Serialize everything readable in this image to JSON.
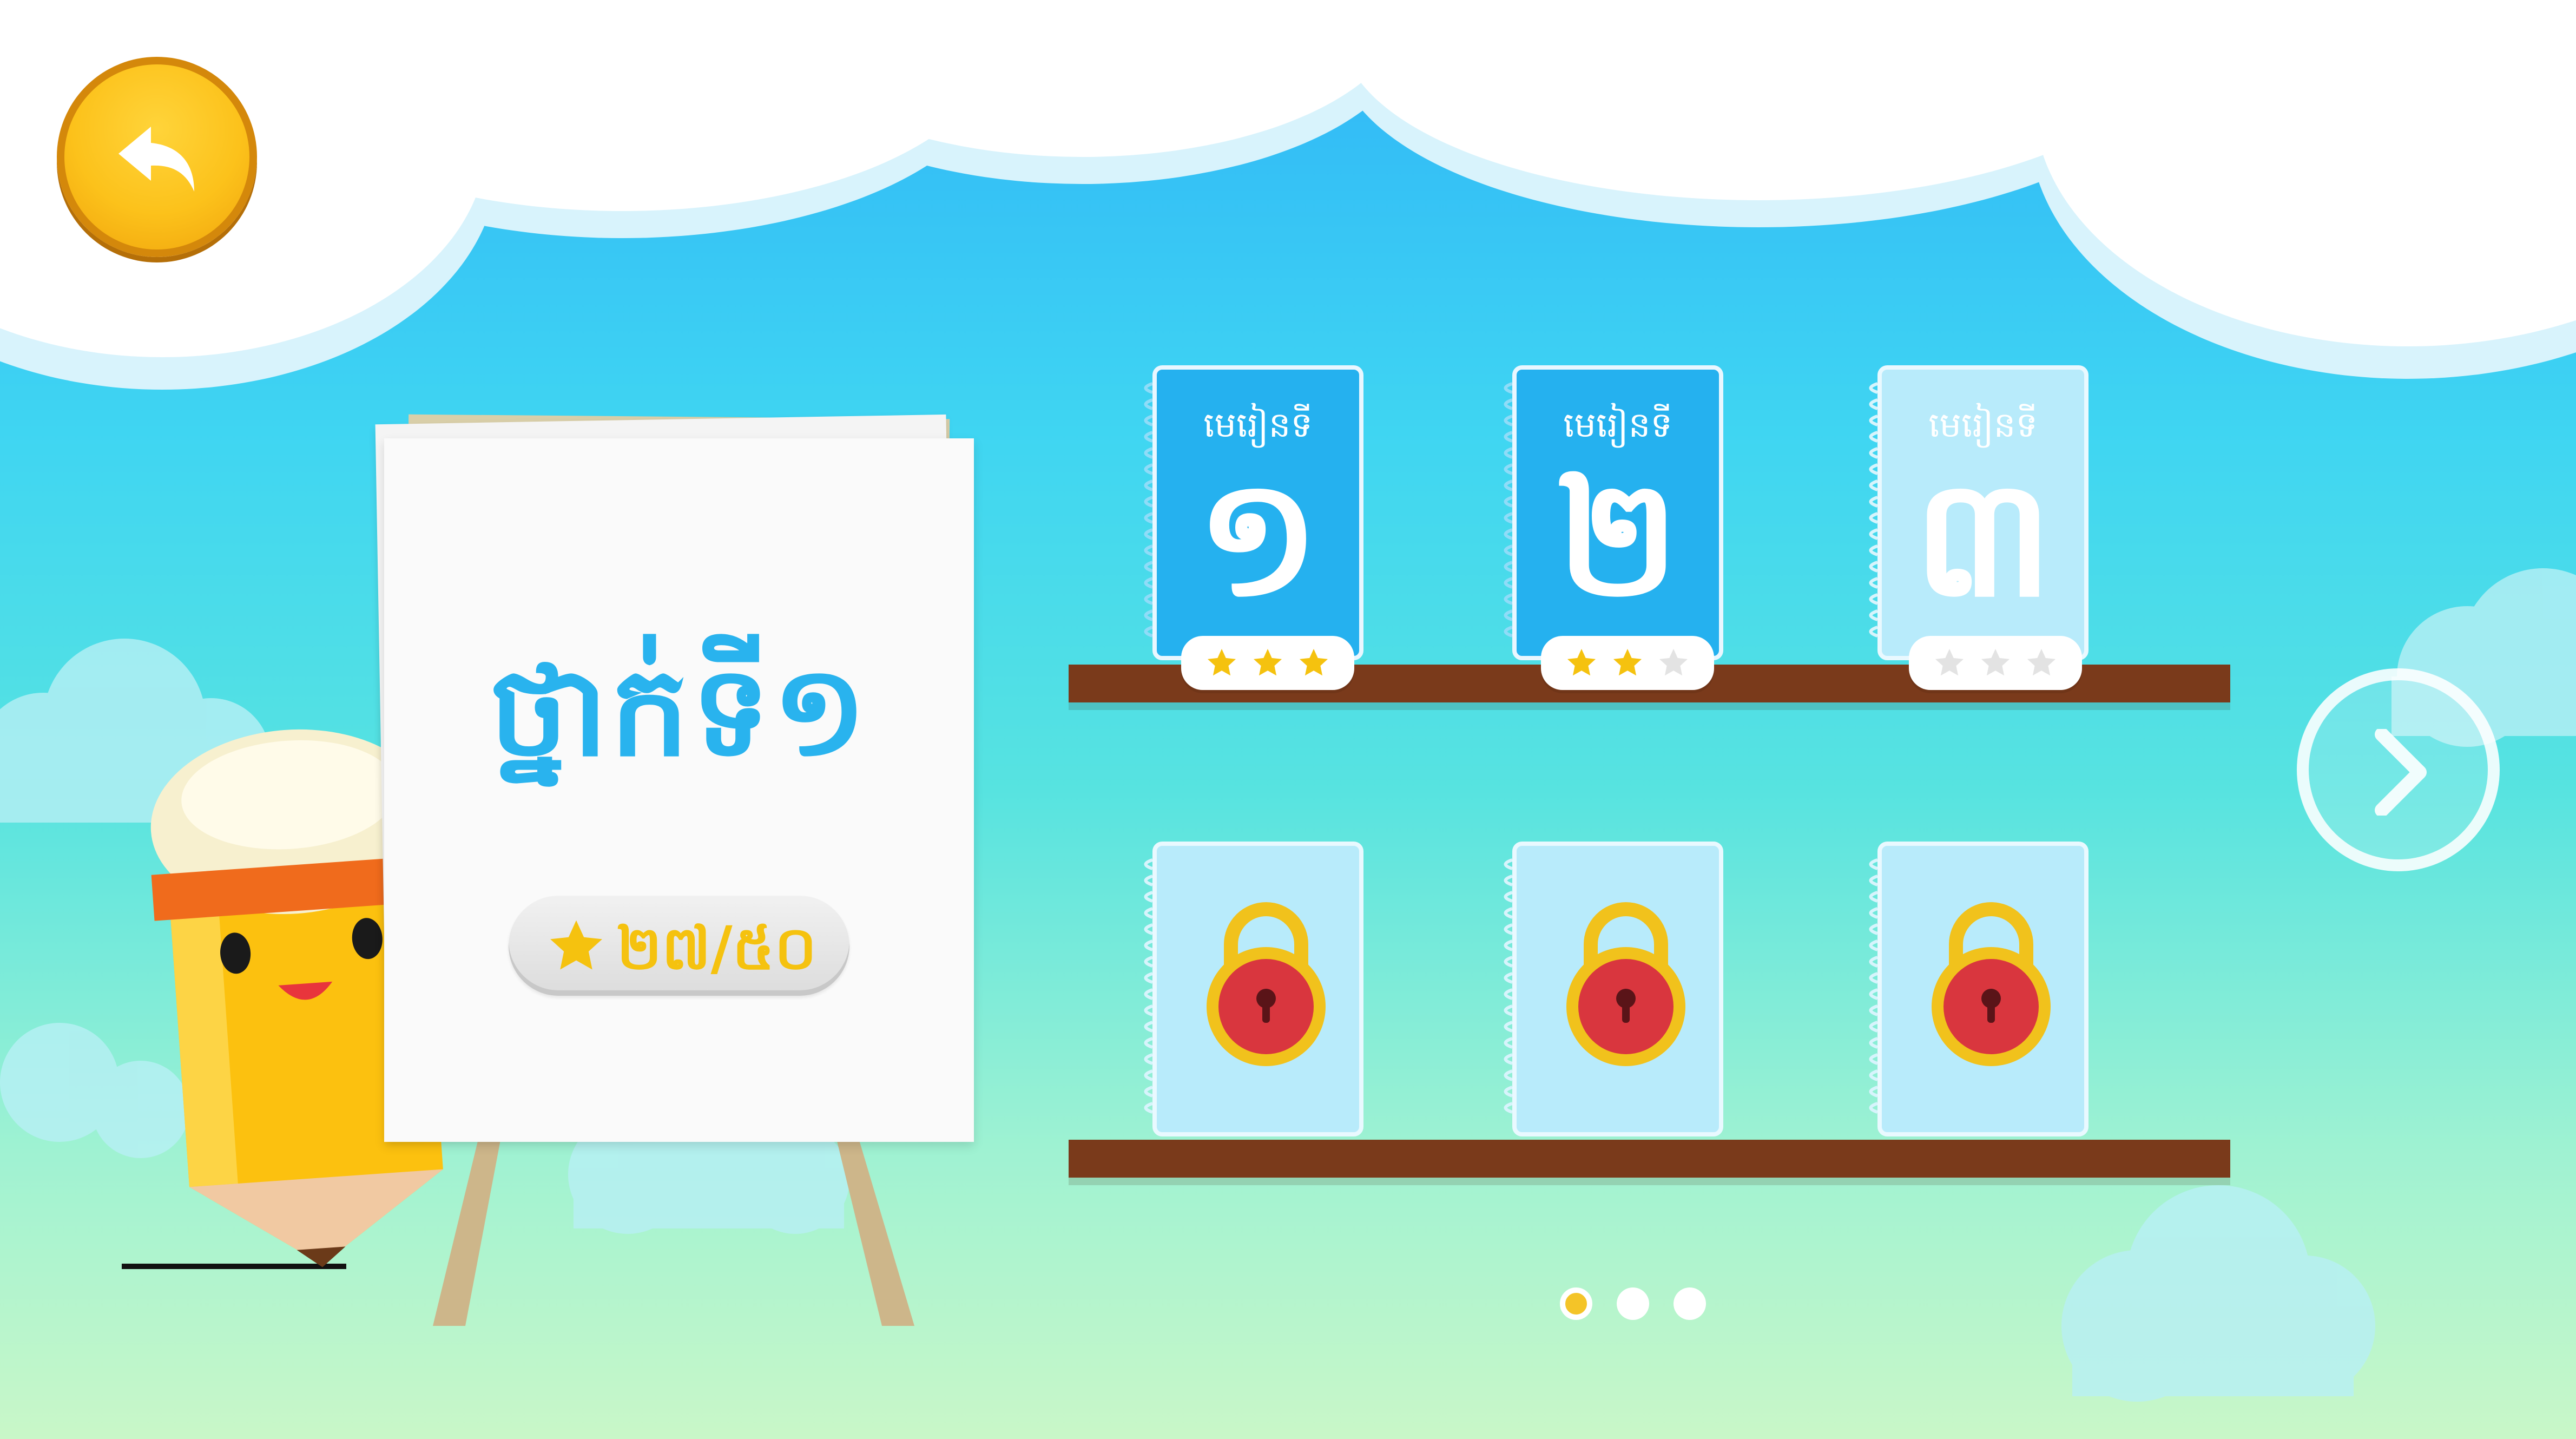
{
  "grade": {
    "title": "ថ្នាក់ទី១",
    "score": "២៧/៥០"
  },
  "navigation": {
    "back_icon": "back-arrow-icon",
    "next_icon": "chevron-right-icon"
  },
  "lessons": [
    {
      "label": "មេរៀនទី",
      "number": "១",
      "stars": 3,
      "max_stars": 3,
      "state": "completed"
    },
    {
      "label": "មេរៀនទី",
      "number": "២",
      "stars": 2,
      "max_stars": 3,
      "state": "completed"
    },
    {
      "label": "មេរៀនទី",
      "number": "៣",
      "stars": 0,
      "max_stars": 3,
      "state": "unlocked"
    },
    {
      "state": "locked",
      "icon": "padlock-icon"
    },
    {
      "state": "locked",
      "icon": "padlock-icon"
    },
    {
      "state": "locked",
      "icon": "padlock-icon"
    }
  ],
  "pagination": {
    "pages": 3,
    "current": 1
  },
  "colors": {
    "accent_blue": "#25b1ef",
    "star_gold": "#f5c20f",
    "shelf_brown": "#7a3a1b",
    "lock_red": "#d9363e"
  }
}
